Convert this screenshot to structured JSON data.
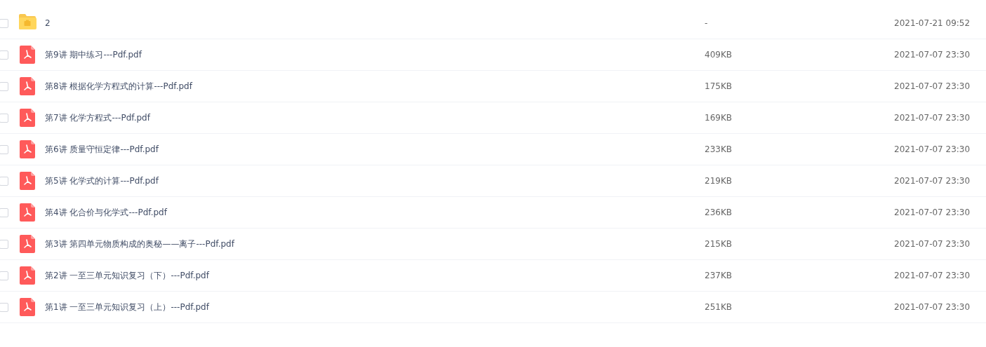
{
  "files": [
    {
      "kind": "folder",
      "name": "2",
      "size": "-",
      "modified": "2021-07-21 09:52",
      "checked": false
    },
    {
      "kind": "pdf",
      "name": "第9讲 期中练习---Pdf.pdf",
      "size": "409KB",
      "modified": "2021-07-07 23:30",
      "checked": false
    },
    {
      "kind": "pdf",
      "name": "第8讲 根据化学方程式的计算---Pdf.pdf",
      "size": "175KB",
      "modified": "2021-07-07 23:30",
      "checked": false
    },
    {
      "kind": "pdf",
      "name": "第7讲 化学方程式---Pdf.pdf",
      "size": "169KB",
      "modified": "2021-07-07 23:30",
      "checked": false
    },
    {
      "kind": "pdf",
      "name": "第6讲 质量守恒定律---Pdf.pdf",
      "size": "233KB",
      "modified": "2021-07-07 23:30",
      "checked": false
    },
    {
      "kind": "pdf",
      "name": "第5讲 化学式的计算---Pdf.pdf",
      "size": "219KB",
      "modified": "2021-07-07 23:30",
      "checked": false
    },
    {
      "kind": "pdf",
      "name": "第4讲 化合价与化学式---Pdf.pdf",
      "size": "236KB",
      "modified": "2021-07-07 23:30",
      "checked": false
    },
    {
      "kind": "pdf",
      "name": "第3讲 第四单元物质构成的奥秘——离子---Pdf.pdf",
      "size": "215KB",
      "modified": "2021-07-07 23:30",
      "checked": false
    },
    {
      "kind": "pdf",
      "name": "第2讲 一至三单元知识复习（下）---Pdf.pdf",
      "size": "237KB",
      "modified": "2021-07-07 23:30",
      "checked": false
    },
    {
      "kind": "pdf",
      "name": "第1讲 一至三单元知识复习（上）---Pdf.pdf",
      "size": "251KB",
      "modified": "2021-07-07 23:30",
      "checked": false
    }
  ]
}
